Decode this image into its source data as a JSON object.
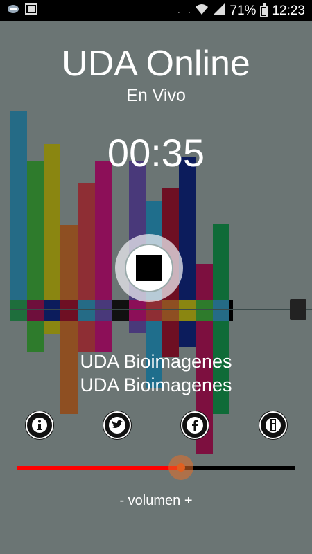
{
  "status_bar": {
    "battery": "71%",
    "time": "12:23"
  },
  "player": {
    "app_title": "UDA Online",
    "subtitle": "En Vivo",
    "elapsed": "00:35",
    "track_line1": "UDA Bioimagenes",
    "track_line2": "UDA Bioimagenes",
    "state": "playing"
  },
  "social": [
    {
      "name": "info-button",
      "icon": "info-icon"
    },
    {
      "name": "twitter-button",
      "icon": "twitter-icon"
    },
    {
      "name": "facebook-button",
      "icon": "facebook-icon"
    },
    {
      "name": "more-button",
      "icon": "more-icon"
    }
  ],
  "volume": {
    "label": "- volumen +",
    "level": 0.59
  },
  "colors": {
    "background": "#6b7574",
    "volume_fill": "#ff0000",
    "volume_track": "#000000",
    "volume_thumb": "#e06020"
  }
}
